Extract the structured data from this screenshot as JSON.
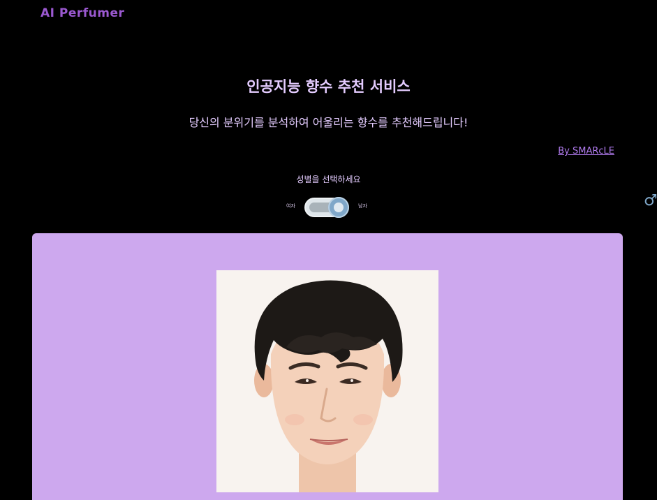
{
  "header": {
    "logo": "AI Perfumer"
  },
  "hero": {
    "title": "인공지능 향수 추천 서비스",
    "subtitle": "당신의 분위기를 분석하여 어울리는 향수를 추천해드립니다!",
    "byline": "By SMARcLE"
  },
  "gender": {
    "prompt": "성별을 선택하세요",
    "female_label": "여자",
    "male_label": "남자",
    "selected_icon": "male-icon",
    "selected": "male"
  },
  "panel": {
    "background": "#cda8ee",
    "photo_subject": "person-portrait"
  },
  "colors": {
    "background": "#000000",
    "accent": "#9b59d0",
    "title_text": "#e4ccff",
    "toggle_knob": "#7fa7c9"
  }
}
